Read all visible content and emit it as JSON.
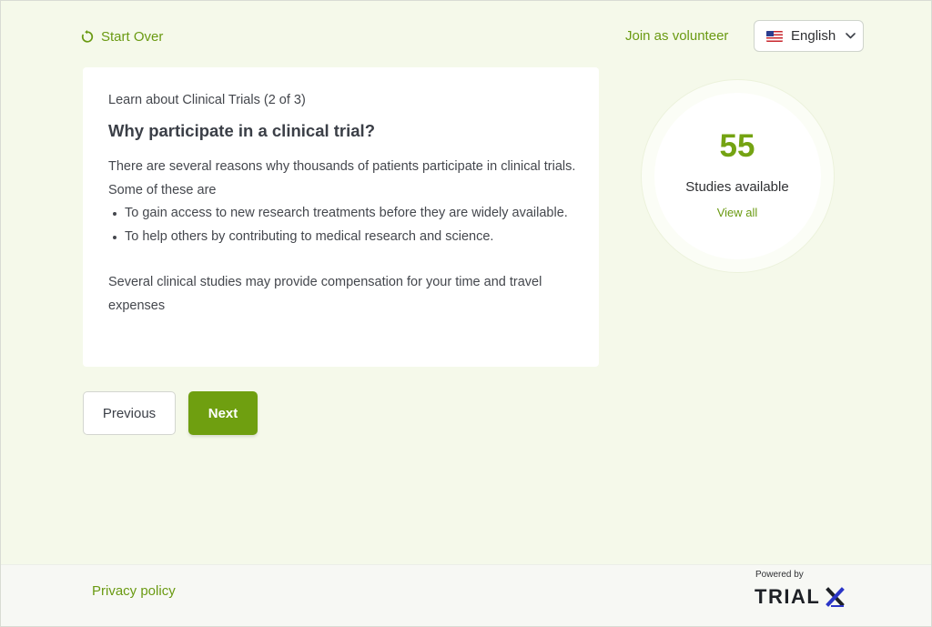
{
  "header": {
    "start_over_label": "Start Over",
    "join_label": "Join as volunteer",
    "language": "English"
  },
  "card": {
    "kicker": "Learn about Clinical Trials (2 of 3)",
    "heading": "Why participate in a clinical trial?",
    "intro": "There are several reasons why thousands of patients participate in clinical trials. Some of these are",
    "bullets": [
      "To gain access to new research treatments before they are widely available.",
      "To help others by contributing to medical research and science."
    ],
    "closing": "Several clinical studies may provide compensation for your time and travel expenses"
  },
  "navigation": {
    "previous_label": "Previous",
    "next_label": "Next"
  },
  "studies": {
    "count": "55",
    "label": "Studies available",
    "link": "View all"
  },
  "footer": {
    "privacy_label": "Privacy policy",
    "powered_by": "Powered by",
    "logo_text": "TRIALX"
  },
  "colors": {
    "accent": "#6f9f10",
    "link": "#6a9a12",
    "background": "#f5f9ea"
  }
}
